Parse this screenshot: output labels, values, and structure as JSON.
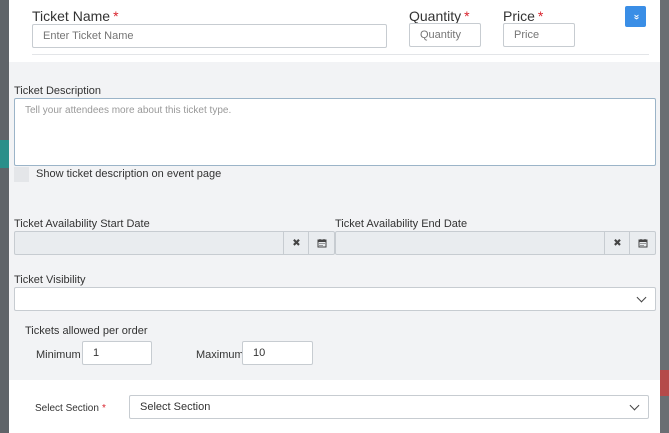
{
  "ticket_name": {
    "label": "Ticket Name",
    "required_mark": "*",
    "placeholder": "Enter Ticket Name"
  },
  "quantity": {
    "label": "Quantity",
    "required_mark": "*",
    "placeholder": "Quantity"
  },
  "price": {
    "label": "Price",
    "required_mark": "*",
    "placeholder": "Price"
  },
  "expand_button": {
    "icon": "double-chevron-down-icon",
    "glyph": "»"
  },
  "description": {
    "label": "Ticket Description",
    "placeholder": "Tell your attendees more about this ticket type.",
    "show_on_page_label": "Show ticket description on event page"
  },
  "availability": {
    "start_label": "Ticket Availability Start Date",
    "end_label": "Ticket Availability End Date",
    "clear_glyph": "✖",
    "calendar_icon": "calendar-icon"
  },
  "visibility": {
    "label": "Ticket Visibility",
    "value": ""
  },
  "per_order": {
    "label": "Tickets allowed per order",
    "min_label": "Minimum",
    "min_value": "1",
    "max_label": "Maximum",
    "max_value": "10"
  },
  "section": {
    "label": "Select Section",
    "required_mark": "*",
    "value": "Select Section"
  },
  "colors": {
    "accent": "#3a8ee6",
    "required": "#d9232d",
    "panel": "#f2f3f5"
  }
}
